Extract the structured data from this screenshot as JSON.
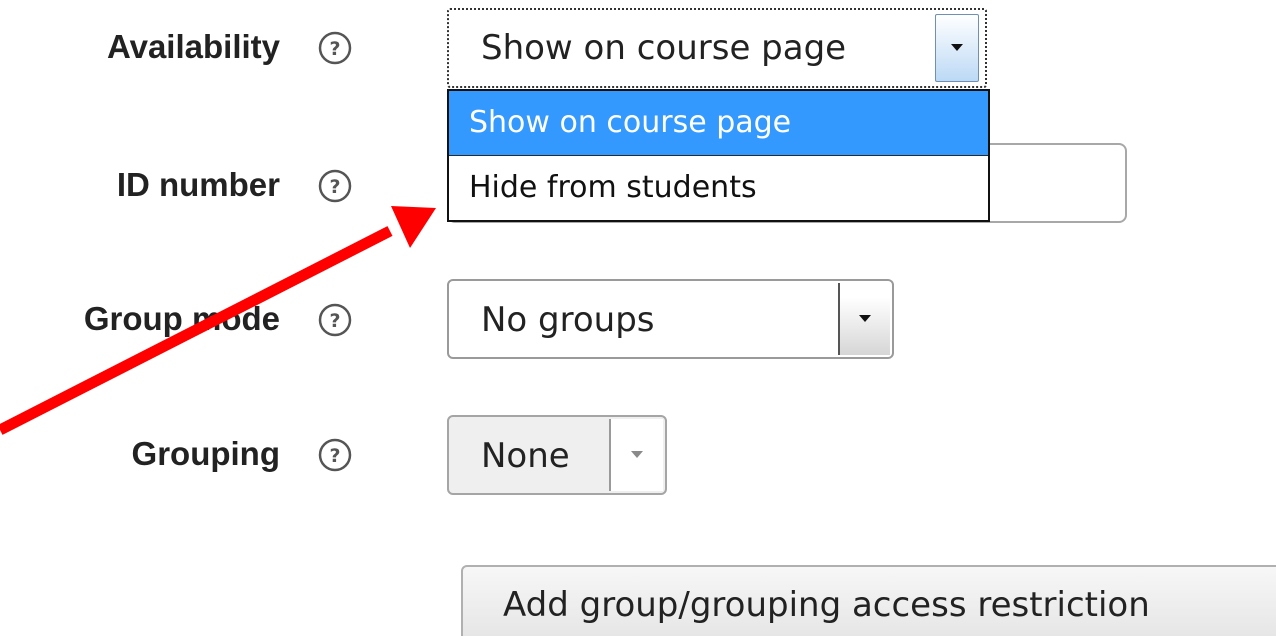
{
  "form": {
    "availability": {
      "label": "Availability",
      "selected": "Show on course page",
      "options": [
        "Show on course page",
        "Hide from students"
      ],
      "highlighted_option_color": "#3399ff"
    },
    "id_number": {
      "label": "ID number",
      "value": ""
    },
    "group_mode": {
      "label": "Group mode",
      "selected": "No groups"
    },
    "grouping": {
      "label": "Grouping",
      "selected": "None"
    },
    "add_restriction_button": "Add group/grouping access restriction"
  },
  "icons": {
    "help": "help-circle-icon",
    "dropdown": "chevron-down-icon",
    "annotation": "red-arrow-annotation"
  },
  "colors": {
    "annotation_arrow": "#ff0000",
    "label_text": "#222222"
  }
}
